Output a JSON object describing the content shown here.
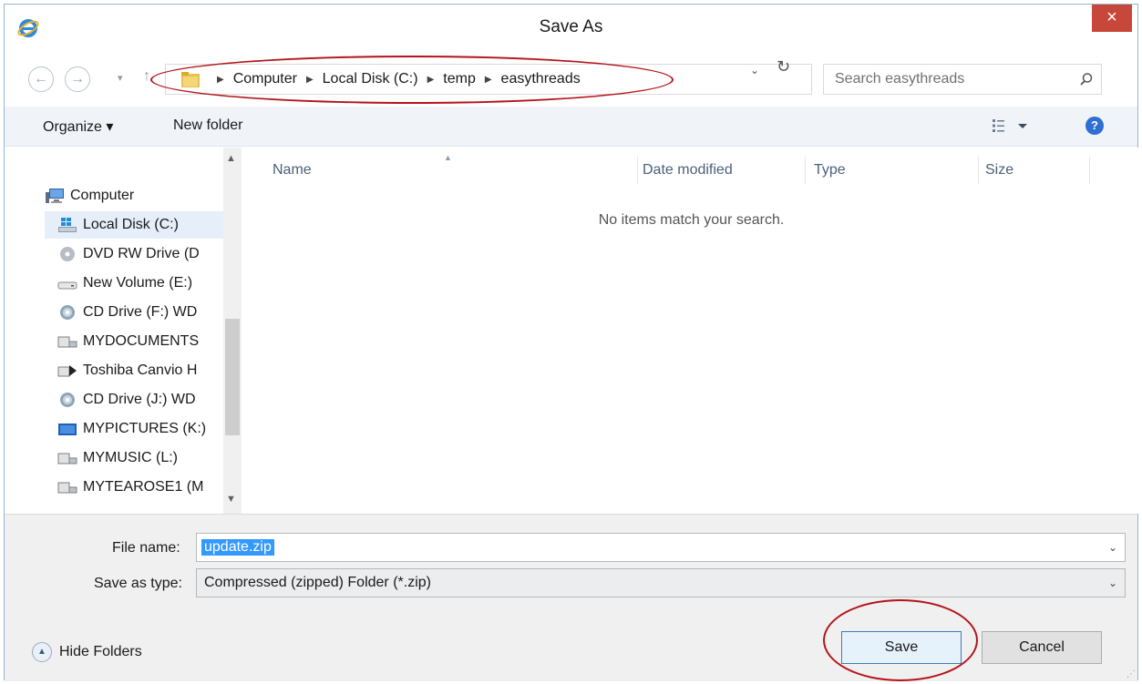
{
  "window": {
    "title": "Save As",
    "close_label": "×"
  },
  "navigation": {
    "back_label": "←",
    "forward_label": "→",
    "recent_label": "▾",
    "up_label": "↑",
    "breadcrumb": [
      "Computer",
      "Local Disk (C:)",
      "temp",
      "easythreads"
    ],
    "address_dropdown_label": "⌄",
    "refresh_label": "↻",
    "search_placeholder": "Search easythreads"
  },
  "toolbar": {
    "organize_label": "Organize ▾",
    "new_folder_label": "New folder",
    "help_label": "?"
  },
  "nav_pane": {
    "items": [
      {
        "label": "Computer",
        "icon": "computer-icon"
      },
      {
        "label": "Local Disk (C:)",
        "icon": "local-disk-icon",
        "selected": true
      },
      {
        "label": "DVD RW Drive (D",
        "icon": "dvd-drive-icon"
      },
      {
        "label": "New Volume (E:)",
        "icon": "drive-icon"
      },
      {
        "label": "CD Drive (F:) WD",
        "icon": "cd-drive-icon"
      },
      {
        "label": "MYDOCUMENTS",
        "icon": "network-drive-icon"
      },
      {
        "label": "Toshiba Canvio H",
        "icon": "network-drive-icon"
      },
      {
        "label": "CD Drive (J:) WD",
        "icon": "cd-drive-icon"
      },
      {
        "label": "MYPICTURES (K:)",
        "icon": "network-drive-icon"
      },
      {
        "label": "MYMUSIC (L:)",
        "icon": "network-drive-icon"
      },
      {
        "label": "MYTEAROSE1 (M",
        "icon": "network-drive-icon"
      }
    ]
  },
  "file_list": {
    "columns": [
      "Name",
      "Date modified",
      "Type",
      "Size"
    ],
    "empty_message": "No items match your search."
  },
  "form": {
    "file_name_label": "File name:",
    "file_name_value": "update.zip",
    "save_as_type_label": "Save as type:",
    "save_as_type_value": "Compressed (zipped) Folder (*.zip)"
  },
  "footer": {
    "hide_folders_label": "Hide Folders",
    "save_label": "Save",
    "cancel_label": "Cancel"
  },
  "colors": {
    "annotation": "#b3141b",
    "selection": "#3399ff",
    "close_button": "#c7483a"
  }
}
